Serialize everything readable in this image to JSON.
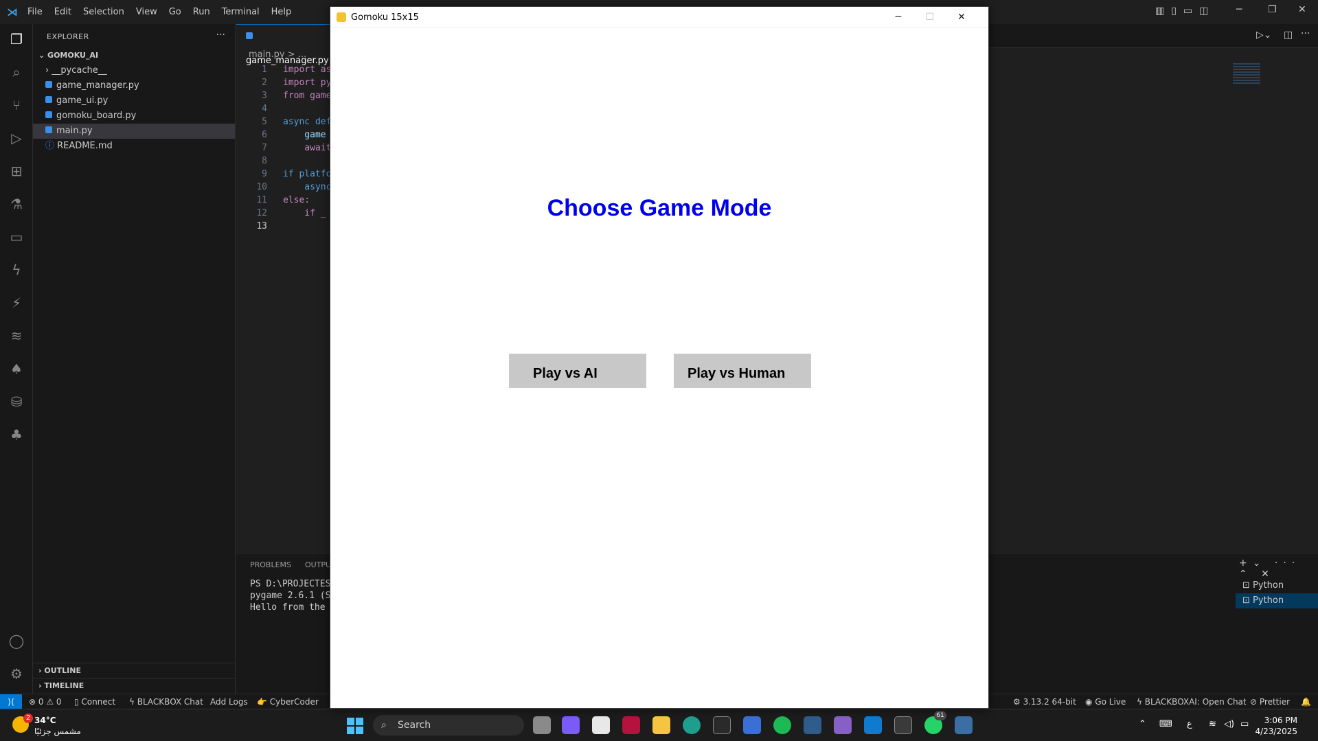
{
  "vscode": {
    "menu": [
      "File",
      "Edit",
      "Selection",
      "View",
      "Go",
      "Run",
      "Terminal",
      "Help"
    ],
    "explorer_title": "EXPLORER",
    "explorer_more": "···",
    "project": "GOMOKU_AI",
    "files": [
      "__pycache__",
      "game_manager.py",
      "game_ui.py",
      "gomoku_board.py",
      "main.py",
      "README.md"
    ],
    "outline": "OUTLINE",
    "timeline": "TIMELINE",
    "active_tab": "game_manager.py",
    "breadcrumb": "main.py > ...",
    "line_numbers": [
      "1",
      "2",
      "3",
      "4",
      "5",
      "6",
      "7",
      "8",
      "9",
      "10",
      "11",
      "12",
      "13"
    ],
    "code_lines": [
      "import as",
      "import py",
      "from game",
      "",
      "async def",
      "    game",
      "    await",
      "",
      "if platfo",
      "    async",
      "else:",
      "    if _",
      ""
    ],
    "panel_tabs": [
      "PROBLEMS",
      "OUTPUT"
    ],
    "terminal_lines": [
      "PS D:\\PROJECTES",
      "pygame 2.6.1 (S",
      "Hello from the"
    ],
    "terminals": [
      "Python",
      "Python"
    ]
  },
  "status": {
    "remote": "⟩⟨",
    "problems": "⊗ 0 ⚠ 0",
    "connect": "Connect",
    "blackbox_chat": "BLACKBOX Chat",
    "add_logs": "Add Logs",
    "cybercoder": "CyberCoder",
    "python_ver": "3.13.2 64-bit",
    "go_live": "Go Live",
    "blackboxai": "BLACKBOXAI: Open Chat",
    "prettier": "Prettier"
  },
  "pygame": {
    "window_title": "Gomoku 15x15",
    "heading": "Choose Game Mode",
    "btn_ai": "Play vs AI",
    "btn_human": "Play vs Human",
    "heading_color": "#0000ee",
    "button_color": "#c8c8c8"
  },
  "taskbar": {
    "weather_temp": "34°C",
    "weather_desc": "مشمس جزئيًا",
    "weather_badge": "2",
    "search": "Search",
    "whatsapp_badge": "61",
    "ime": "ع",
    "time": "3:06 PM",
    "date": "4/23/2025"
  }
}
